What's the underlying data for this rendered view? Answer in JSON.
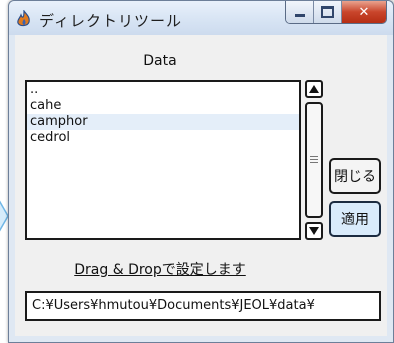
{
  "window": {
    "title": "ディレクトリツール",
    "minimize_icon": "minimize-icon",
    "maximize_icon": "maximize-icon",
    "close_glyph": "✕"
  },
  "main": {
    "data_label": "Data",
    "list_items": [
      "..",
      "cahe",
      "camphor",
      "cedrol"
    ],
    "close_button_label": "閉じる",
    "apply_button_label": "適用",
    "drag_drop_hint": "Drag & Dropで設定します",
    "path_value": "C:¥Users¥hmutou¥Documents¥JEOL¥data¥"
  },
  "colors": {
    "accent": "#d9ebfb",
    "close_button_red": "#c9452b",
    "list_alt_row": "#e4eef9"
  }
}
